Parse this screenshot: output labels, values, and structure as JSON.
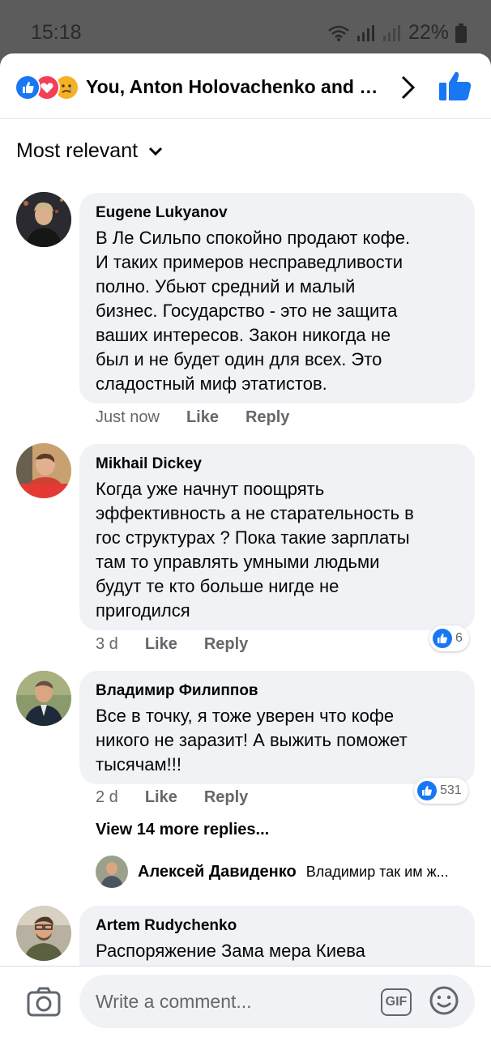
{
  "status_bar": {
    "time": "15:18",
    "battery": "22%"
  },
  "header": {
    "title": "You, Anton Holovachenko and 8...",
    "reactions": [
      "like",
      "love",
      "sad"
    ]
  },
  "sort": {
    "label": "Most relevant"
  },
  "comments": [
    {
      "author": "Eugene Lukyanov",
      "lines": [
        "В Ле Сильпо спокойно продают кофе.",
        "И таких примеров несправедливости",
        "полно. Убьют средний и малый",
        "бизнес. Государство - это не защита",
        "ваших интересов. Закон никогда не",
        "был и не будет один для всех. Это",
        "сладостный миф этатистов."
      ],
      "time": "Just now",
      "like_label": "Like",
      "reply_label": "Reply"
    },
    {
      "author": "Mikhail Dickey",
      "lines": [
        "Когда уже начнут поощрять",
        "эффективность а не старательность в",
        "гос структурах ?  Пока такие зарплаты",
        "там то управлять умными людьми",
        "будут те кто больше нигде не",
        "пригодился"
      ],
      "time": "3 d",
      "like_label": "Like",
      "reply_label": "Reply",
      "reaction_count": "6"
    },
    {
      "author": "Владимир Филиппов",
      "lines": [
        "Все в точку, я тоже уверен что кофе",
        "никого не заразит! А выжить поможет",
        "тысячам!!!"
      ],
      "time": "2 d",
      "like_label": "Like",
      "reply_label": "Reply",
      "reaction_count": "531",
      "more_replies": "View 14 more replies...",
      "reply_preview": {
        "author": "Алексей Давиденко",
        "text": "Владимир так им ж..."
      }
    },
    {
      "author": "Artem Rudychenko",
      "lines": [
        "Распоряжение Зама мера Киева"
      ]
    }
  ],
  "composer": {
    "placeholder": "Write a comment...",
    "gif_label": "GIF"
  },
  "colors": {
    "accent": "#1877f2",
    "love": "#f33e58",
    "sad": "#f7b125",
    "bubble": "#f0f2f5",
    "meta": "#65676b"
  }
}
